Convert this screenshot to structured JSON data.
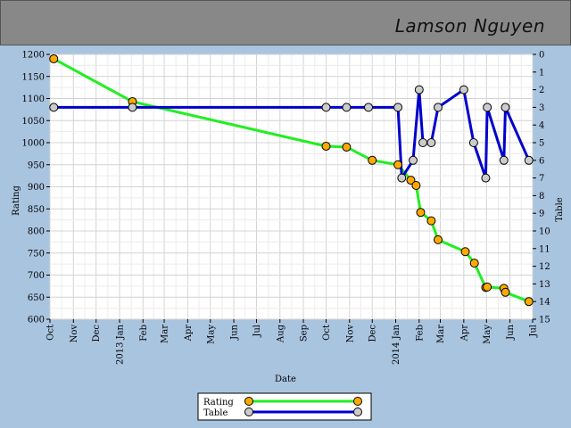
{
  "header": {
    "player_name": "Lamson Nguyen"
  },
  "chart_data": {
    "type": "line",
    "xlabel": "Date",
    "ylabel_left": "Rating",
    "ylabel_right": "Table",
    "x_range": [
      "2012-10-01",
      "2014-07-01"
    ],
    "ylim_left": [
      600,
      1200
    ],
    "ylim_right": [
      15,
      0
    ],
    "x_ticks": [
      {
        "date": "2012-10-01",
        "label": "Oct"
      },
      {
        "date": "2012-11-01",
        "label": "Nov"
      },
      {
        "date": "2012-12-01",
        "label": "Dec"
      },
      {
        "date": "2013-01-01",
        "label": "2013 Jan"
      },
      {
        "date": "2013-02-01",
        "label": "Feb"
      },
      {
        "date": "2013-03-01",
        "label": "Mar"
      },
      {
        "date": "2013-04-01",
        "label": "Apr"
      },
      {
        "date": "2013-05-01",
        "label": "May"
      },
      {
        "date": "2013-06-01",
        "label": "Jun"
      },
      {
        "date": "2013-07-01",
        "label": "Jul"
      },
      {
        "date": "2013-08-01",
        "label": "Aug"
      },
      {
        "date": "2013-09-01",
        "label": "Sep"
      },
      {
        "date": "2013-10-01",
        "label": "Oct"
      },
      {
        "date": "2013-11-01",
        "label": "Nov"
      },
      {
        "date": "2013-12-01",
        "label": "Dec"
      },
      {
        "date": "2014-01-01",
        "label": "2014 Jan"
      },
      {
        "date": "2014-02-01",
        "label": "Feb"
      },
      {
        "date": "2014-03-01",
        "label": "Mar"
      },
      {
        "date": "2014-04-01",
        "label": "Apr"
      },
      {
        "date": "2014-05-01",
        "label": "May"
      },
      {
        "date": "2014-06-01",
        "label": "Jun"
      },
      {
        "date": "2014-07-01",
        "label": "Jul"
      }
    ],
    "y_ticks_left": [
      600,
      650,
      700,
      750,
      800,
      850,
      900,
      950,
      1000,
      1050,
      1100,
      1150,
      1200
    ],
    "y_ticks_right": [
      0,
      1,
      2,
      3,
      4,
      5,
      6,
      7,
      8,
      9,
      10,
      11,
      12,
      13,
      14,
      15
    ],
    "grid": true,
    "legend_position": "bottom-center",
    "series": [
      {
        "name": "Rating",
        "axis": "left",
        "line_color": "#22ee22",
        "marker_color": "#ffaa00",
        "points": [
          {
            "x": "2012-10-06",
            "y": 1190
          },
          {
            "x": "2013-01-18",
            "y": 1093
          },
          {
            "x": "2013-10-01",
            "y": 992
          },
          {
            "x": "2013-10-28",
            "y": 990
          },
          {
            "x": "2013-12-01",
            "y": 960
          },
          {
            "x": "2014-01-04",
            "y": 950
          },
          {
            "x": "2014-01-21",
            "y": 915
          },
          {
            "x": "2014-01-28",
            "y": 903
          },
          {
            "x": "2014-02-03",
            "y": 842
          },
          {
            "x": "2014-02-17",
            "y": 823
          },
          {
            "x": "2014-02-26",
            "y": 780
          },
          {
            "x": "2014-04-03",
            "y": 753
          },
          {
            "x": "2014-04-15",
            "y": 727
          },
          {
            "x": "2014-04-30",
            "y": 672
          },
          {
            "x": "2014-05-02",
            "y": 673
          },
          {
            "x": "2014-05-24",
            "y": 670
          },
          {
            "x": "2014-05-26",
            "y": 661
          },
          {
            "x": "2014-06-26",
            "y": 640
          }
        ]
      },
      {
        "name": "Table",
        "axis": "right",
        "line_color": "#0000cc",
        "marker_color": "#cccccc",
        "points": [
          {
            "x": "2012-10-06",
            "y": 3
          },
          {
            "x": "2013-01-18",
            "y": 3
          },
          {
            "x": "2013-10-01",
            "y": 3
          },
          {
            "x": "2013-10-28",
            "y": 3
          },
          {
            "x": "2013-11-26",
            "y": 3
          },
          {
            "x": "2014-01-04",
            "y": 3
          },
          {
            "x": "2014-01-09",
            "y": 7
          },
          {
            "x": "2014-01-24",
            "y": 6
          },
          {
            "x": "2014-02-01",
            "y": 2
          },
          {
            "x": "2014-02-06",
            "y": 5
          },
          {
            "x": "2014-02-17",
            "y": 5
          },
          {
            "x": "2014-02-26",
            "y": 3
          },
          {
            "x": "2014-04-01",
            "y": 2
          },
          {
            "x": "2014-04-14",
            "y": 5
          },
          {
            "x": "2014-04-30",
            "y": 7
          },
          {
            "x": "2014-05-02",
            "y": 3
          },
          {
            "x": "2014-05-24",
            "y": 6
          },
          {
            "x": "2014-05-26",
            "y": 3
          },
          {
            "x": "2014-06-26",
            "y": 6
          }
        ]
      }
    ]
  }
}
